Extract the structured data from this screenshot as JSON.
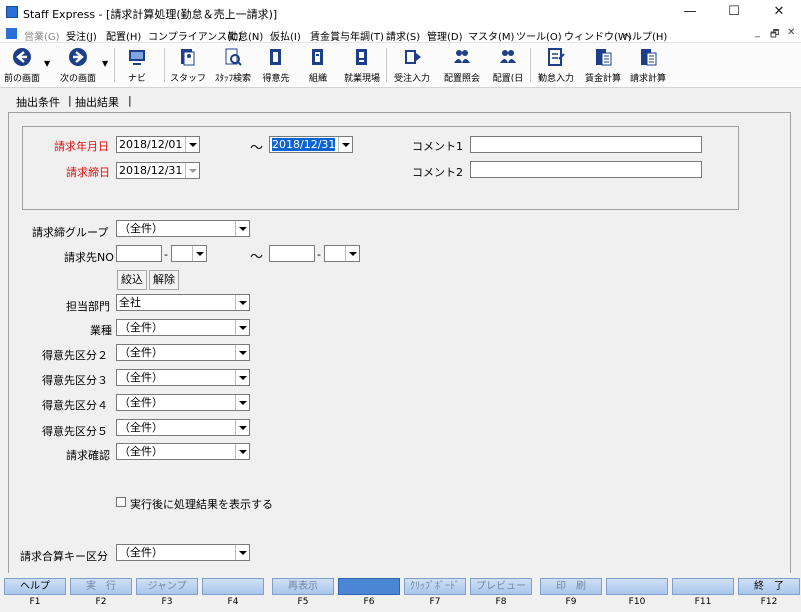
{
  "window": {
    "title": "Staff Express - [請求計算処理(勤怠＆売上一請求)]",
    "minimize": "—",
    "maximize": "☐",
    "close": "✕"
  },
  "menu": {
    "items": [
      "営業(G)",
      "受注(J)",
      "配置(H)",
      "コンプライアンス(C)",
      "勤怠(N)",
      "仮払(I)",
      "賃金賞与年調(T)",
      "請求(S)",
      "管理(D)",
      "マスタ(M)",
      "ツール(O)",
      "ウィンドウ(W)",
      "ヘルプ(H)"
    ],
    "mdi_controls": [
      "_",
      "🗗",
      "✕"
    ]
  },
  "toolbar": {
    "buttons": [
      "前の画面",
      "次の画面",
      "ナビ",
      "スタッフ",
      "ｽﾀｯﾌ検索",
      "得意先",
      "組織",
      "就業現場",
      "受注入力",
      "配置照会",
      "配置(日",
      "勤怠入力",
      "賃金計算",
      "請求計算"
    ]
  },
  "tabs": [
    "抽出条件",
    "抽出結果"
  ],
  "conditions": {
    "billing_month_label": "請求年月日",
    "billing_from": "2018/12/01",
    "tilde": "～",
    "billing_to": "2018/12/31",
    "closing_label": "請求締日",
    "closing_date": "2018/12/31",
    "comment1_label": "コメント1",
    "comment1_value": "",
    "comment2_label": "コメント2",
    "comment2_value": "",
    "closing_group_label": "請求締グループ",
    "closing_group_value": "（全件）",
    "billto_label": "請求先NO",
    "dash": "-",
    "narrow_button": "絞込",
    "clear_button": "解除",
    "dept_label": "担当部門",
    "dept_value": "全社",
    "industry_label": "業種",
    "industry_value": "（全件）",
    "cat2_label": "得意先区分２",
    "cat2_value": "（全件）",
    "cat3_label": "得意先区分３",
    "cat3_value": "（全件）",
    "cat4_label": "得意先区分４",
    "cat4_value": "（全件）",
    "cat5_label": "得意先区分５",
    "cat5_value": "（全件）",
    "confirm_label": "請求確認",
    "confirm_value": "（全件）",
    "show_result_label": "実行後に処理結果を表示する",
    "sum_key_label": "請求合算キー区分",
    "sum_key_value": "（全件）"
  },
  "fkeys": [
    {
      "label": "ヘルプ",
      "key": "F1"
    },
    {
      "label": "実　行",
      "key": "F2"
    },
    {
      "label": "ジャンプ",
      "key": "F3"
    },
    {
      "label": "",
      "key": "F4"
    },
    {
      "label": "再表示",
      "key": "F5"
    },
    {
      "label": "",
      "key": "F6"
    },
    {
      "label": "ｸﾘｯﾌﾟﾎﾞｰﾄﾞ",
      "key": "F7"
    },
    {
      "label": "プレビュー",
      "key": "F8"
    },
    {
      "label": "印　刷",
      "key": "F9"
    },
    {
      "label": "",
      "key": "F10"
    },
    {
      "label": "",
      "key": "F11"
    },
    {
      "label": "終　了",
      "key": "F12"
    }
  ]
}
